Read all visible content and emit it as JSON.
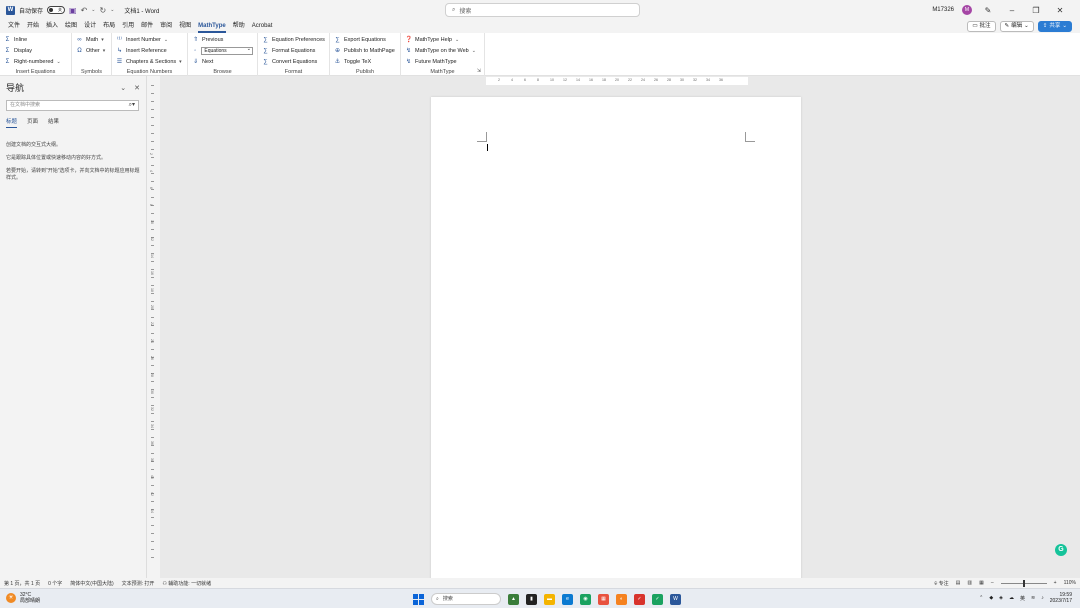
{
  "titlebar": {
    "autosave_label": "自动保存",
    "autosave_state": "关",
    "doc_title": "文档1 - Word",
    "search_placeholder": "搜索",
    "user_id": "M17326",
    "avatar_initial": "M"
  },
  "menu": {
    "tabs": [
      "文件",
      "开始",
      "插入",
      "绘图",
      "设计",
      "布局",
      "引用",
      "邮件",
      "审阅",
      "视图",
      "MathType",
      "帮助",
      "Acrobat"
    ],
    "active_tab": "MathType",
    "comment_label": "批注",
    "edit_label": "编辑",
    "share_label": "共享"
  },
  "ribbon": {
    "insert_equations": {
      "items": [
        "Inline",
        "Display",
        "Right-numbered"
      ],
      "label": "Insert Equations"
    },
    "symbols": {
      "items": [
        "Math",
        "Other"
      ],
      "label": "Symbols"
    },
    "equation_numbers": {
      "items": [
        "Insert Number",
        "Insert Reference",
        "Chapters & Sections"
      ],
      "label": "Equation Numbers"
    },
    "browse": {
      "previous": "Previous",
      "select_value": "Equations",
      "next": "Next",
      "label": "Browse"
    },
    "format": {
      "items": [
        "Equation Preferences",
        "Format Equations",
        "Convert Equations"
      ],
      "label": "Format"
    },
    "publish": {
      "items": [
        "Export Equations",
        "Publish to MathPage",
        "Toggle TeX"
      ],
      "label": "Publish"
    },
    "mathtype": {
      "items": [
        "MathType Help",
        "MathType on the Web",
        "Future MathType"
      ],
      "label": "MathType"
    }
  },
  "nav": {
    "title": "导航",
    "search_placeholder": "在文档中搜索",
    "tabs": [
      "标题",
      "页面",
      "结果"
    ],
    "active_tab": "标题",
    "text1": "创建文档的交互式大纲。",
    "text2": "它是跟踪具体位置或快速移动内容的好方式。",
    "text3": "若要开始，请转到\"开始\"选项卡，并向文档中的标题应用标题样式。"
  },
  "hruler_numbers": [
    "2",
    "4",
    "6",
    "8",
    "10",
    "12",
    "14",
    "16",
    "18",
    "20",
    "22",
    "24",
    "26",
    "28",
    "30",
    "32",
    "34",
    "36"
  ],
  "vruler_numbers": [
    "2",
    "4",
    "6",
    "8",
    "10",
    "12",
    "14",
    "16",
    "18",
    "20",
    "22",
    "24",
    "26",
    "28",
    "30",
    "32",
    "34",
    "36",
    "38",
    "40",
    "42",
    "44"
  ],
  "status": {
    "page": "第 1 页，共 1 页",
    "words": "0 个字",
    "language": "简体中文(中国大陆)",
    "text_predict": "文本预测: 打开",
    "accessibility": "辅助功能: 一切就绪",
    "focus": "专注",
    "zoom": "110%"
  },
  "taskbar": {
    "temp": "32°C",
    "weather": "局部晴朗",
    "search": "搜索",
    "time": "19:59",
    "date": "2023/7/17",
    "ime": "英"
  }
}
